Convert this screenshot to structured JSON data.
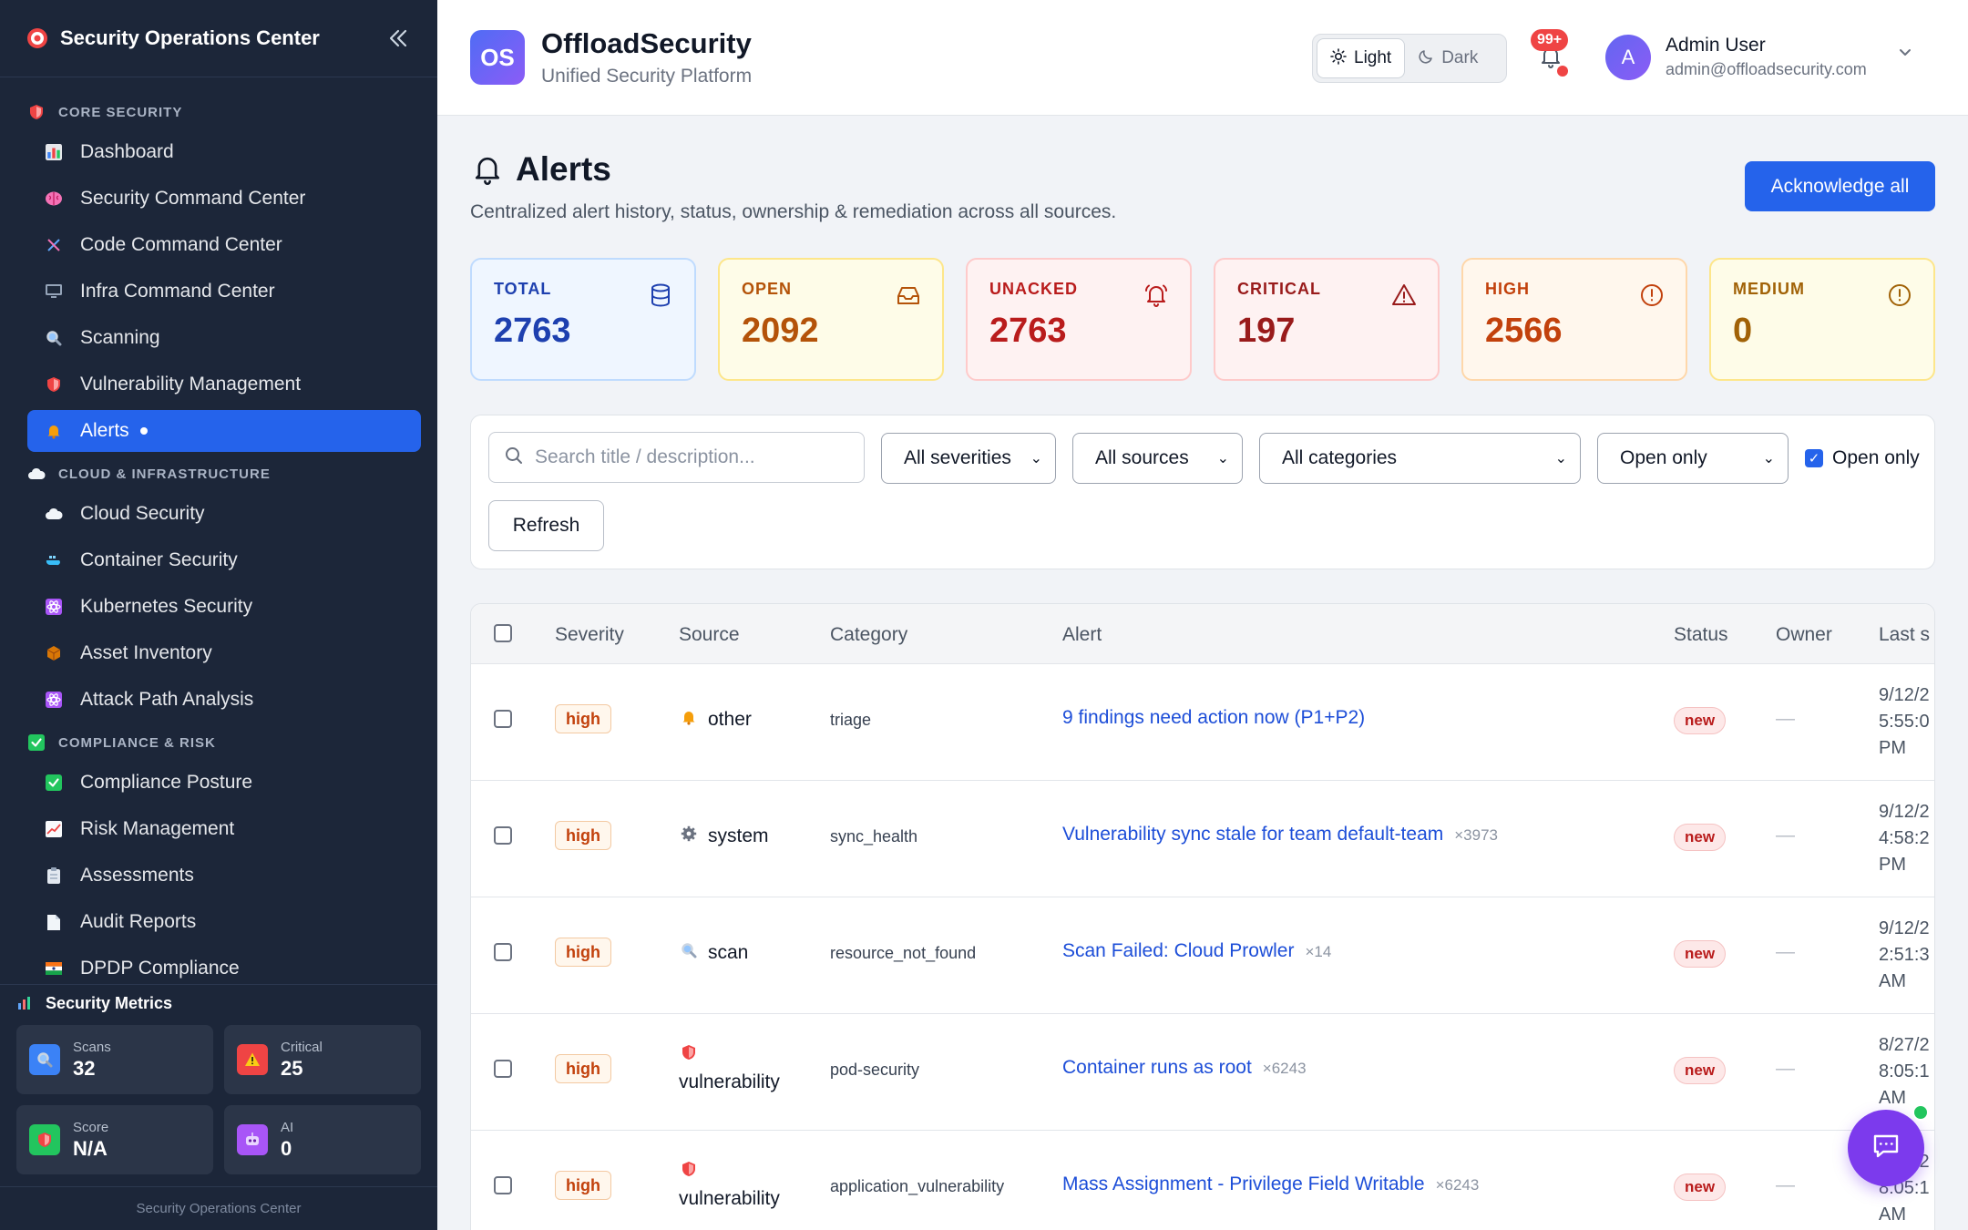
{
  "sidebar": {
    "title": "Security Operations Center",
    "sections": [
      {
        "label": "CORE SECURITY",
        "icon": "shield-icon",
        "items": [
          {
            "label": "Dashboard",
            "icon": "bar-chart-icon"
          },
          {
            "label": "Security Command Center",
            "icon": "brain-icon"
          },
          {
            "label": "Code Command Center",
            "icon": "dna-icon"
          },
          {
            "label": "Infra Command Center",
            "icon": "monitor-icon"
          },
          {
            "label": "Scanning",
            "icon": "magnifier-icon"
          },
          {
            "label": "Vulnerability Management",
            "icon": "shield-icon"
          },
          {
            "label": "Alerts",
            "icon": "bell-icon",
            "active": true
          }
        ]
      },
      {
        "label": "CLOUD & INFRASTRUCTURE",
        "icon": "cloud-icon",
        "items": [
          {
            "label": "Cloud Security",
            "icon": "cloud-icon"
          },
          {
            "label": "Container Security",
            "icon": "whale-icon"
          },
          {
            "label": "Kubernetes Security",
            "icon": "atom-icon"
          },
          {
            "label": "Asset Inventory",
            "icon": "package-icon"
          },
          {
            "label": "Attack Path Analysis",
            "icon": "atom-icon"
          }
        ]
      },
      {
        "label": "COMPLIANCE & RISK",
        "icon": "check-icon",
        "items": [
          {
            "label": "Compliance Posture",
            "icon": "check-icon"
          },
          {
            "label": "Risk Management",
            "icon": "trend-icon"
          },
          {
            "label": "Assessments",
            "icon": "clipboard-icon"
          },
          {
            "label": "Audit Reports",
            "icon": "document-icon"
          },
          {
            "label": "DPDP Compliance",
            "icon": "flag-icon"
          }
        ]
      }
    ],
    "metrics": {
      "title": "Security Metrics",
      "items": [
        {
          "label": "Scans",
          "value": "32",
          "icon": "magnifier-icon",
          "color": "#3b82f6"
        },
        {
          "label": "Critical",
          "value": "25",
          "icon": "warning-icon",
          "color": "#ef4444"
        },
        {
          "label": "Score",
          "value": "N/A",
          "icon": "shield-icon",
          "color": "#22c55e"
        },
        {
          "label": "AI",
          "value": "0",
          "icon": "robot-icon",
          "color": "#a855f7"
        }
      ]
    },
    "footer": "Security Operations Center"
  },
  "topbar": {
    "logo_text": "OS",
    "brand": "OffloadSecurity",
    "subtitle": "Unified Security Platform",
    "theme_light": "Light",
    "theme_dark": "Dark",
    "notif_badge": "99+",
    "user_initial": "A",
    "user_name": "Admin User",
    "user_email": "admin@offloadsecurity.com"
  },
  "page": {
    "title": "Alerts",
    "description": "Centralized alert history, status, ownership & remediation across all sources.",
    "ack_label": "Acknowledge all"
  },
  "stats": [
    {
      "label": "TOTAL",
      "value": "2763",
      "icon": "database-icon",
      "bg": "#eff6ff",
      "border": "#bfdbfe",
      "color": "#1e40af"
    },
    {
      "label": "OPEN",
      "value": "2092",
      "icon": "inbox-icon",
      "bg": "#fefce8",
      "border": "#fde68a",
      "color": "#b45309"
    },
    {
      "label": "UNACKED",
      "value": "2763",
      "icon": "bell-ring-icon",
      "bg": "#fef2f2",
      "border": "#fecaca",
      "color": "#b91c1c"
    },
    {
      "label": "CRITICAL",
      "value": "197",
      "icon": "warning-icon",
      "bg": "#fef2f2",
      "border": "#fecaca",
      "color": "#991b1b"
    },
    {
      "label": "HIGH",
      "value": "2566",
      "icon": "alert-circle-icon",
      "bg": "#fff7ed",
      "border": "#fed7aa",
      "color": "#c2410c"
    },
    {
      "label": "MEDIUM",
      "value": "0",
      "icon": "alert-circle-icon",
      "bg": "#fefce8",
      "border": "#fde68a",
      "color": "#a16207"
    }
  ],
  "filters": {
    "search_placeholder": "Search title / description...",
    "severity": "All severities",
    "source": "All sources",
    "category": "All categories",
    "state": "Open only",
    "open_only_label": "Open only",
    "refresh": "Refresh"
  },
  "table": {
    "columns": [
      "Severity",
      "Source",
      "Category",
      "Alert",
      "Status",
      "Owner",
      "Last s"
    ],
    "rows": [
      {
        "severity": "high",
        "source": "other",
        "source_icon": "bell-icon",
        "category": "triage",
        "alert": "9 findings need action now (P1+P2)",
        "count": "",
        "status": "new",
        "owner": "—",
        "last_seen": "9/12/2\n5:55:0\nPM"
      },
      {
        "severity": "high",
        "source": "system",
        "source_icon": "gear-icon",
        "category": "sync_health",
        "alert": "Vulnerability sync stale for team default-team",
        "count": "×3973",
        "status": "new",
        "owner": "—",
        "last_seen": "9/12/2\n4:58:2\nPM"
      },
      {
        "severity": "high",
        "source": "scan",
        "source_icon": "magnifier-icon",
        "category": "resource_not_found",
        "alert": "Scan Failed: Cloud Prowler",
        "count": "×14",
        "status": "new",
        "owner": "—",
        "last_seen": "9/12/2\n2:51:3\nAM"
      },
      {
        "severity": "high",
        "source": "vulnerability",
        "source_icon": "shield-icon",
        "category": "pod-security",
        "alert": "Container runs as root",
        "count": "×6243",
        "status": "new",
        "owner": "—",
        "last_seen": "8/27/2\n8:05:1\nAM"
      },
      {
        "severity": "high",
        "source": "vulnerability",
        "source_icon": "shield-icon",
        "category": "application_vulnerability",
        "alert": "Mass Assignment - Privilege Field Writable",
        "count": "×6243",
        "status": "new",
        "owner": "—",
        "last_seen": "8/27/2\n8:05:1\nAM"
      }
    ]
  }
}
